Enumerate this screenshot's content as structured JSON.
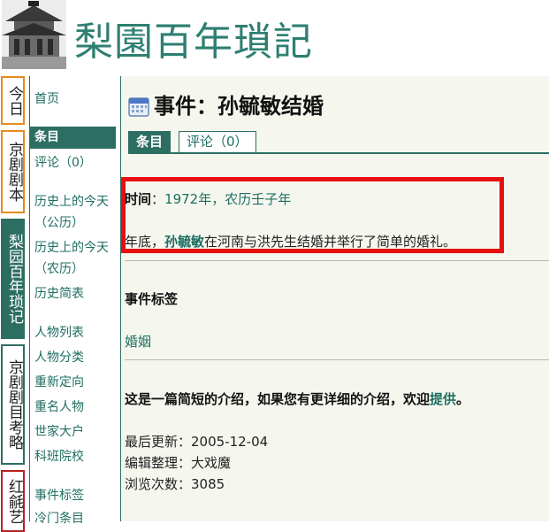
{
  "header": {
    "site_title": "梨園百年瑣記",
    "logo_alt": "古建筑照片"
  },
  "vertical_tabs": [
    {
      "label": "今日",
      "active": false
    },
    {
      "label": "京剧剧本",
      "active": false
    },
    {
      "label": "梨园百年琐记",
      "active": true
    },
    {
      "label": "京剧剧目考略",
      "active": false
    },
    {
      "label": "红毹艺",
      "active": false
    }
  ],
  "nav": {
    "items": [
      "首页",
      "条目",
      "评论（0）",
      "历史上的今天",
      "（公历）",
      "历史上的今天",
      "（农历）",
      "历史简表",
      "人物列表",
      "人物分类",
      "重新定向",
      "重名人物",
      "世家大户",
      "科班院校",
      "事件标签",
      "冷门条目"
    ]
  },
  "main": {
    "title": "事件：孙毓敏结婚",
    "tabs": {
      "active": "条目",
      "comments": "评论（0）"
    },
    "time_label": "时间",
    "time_sep": "：",
    "time_value": "1972年，农历壬子年",
    "body_prefix": "年底，",
    "body_person": "孙毓敏",
    "body_suffix": "在河南与洪先生结婚并举行了简单的婚礼。",
    "tags_heading": "事件标签",
    "tag": "婚姻",
    "note_prefix": "这是一篇简短的介绍，如果您有更详细的介绍，欢迎",
    "note_link": "提供",
    "note_suffix": "。",
    "updated": "最后更新：2005-12-04",
    "editor": "编辑整理：大戏魔",
    "views": "浏览次数：3085"
  }
}
